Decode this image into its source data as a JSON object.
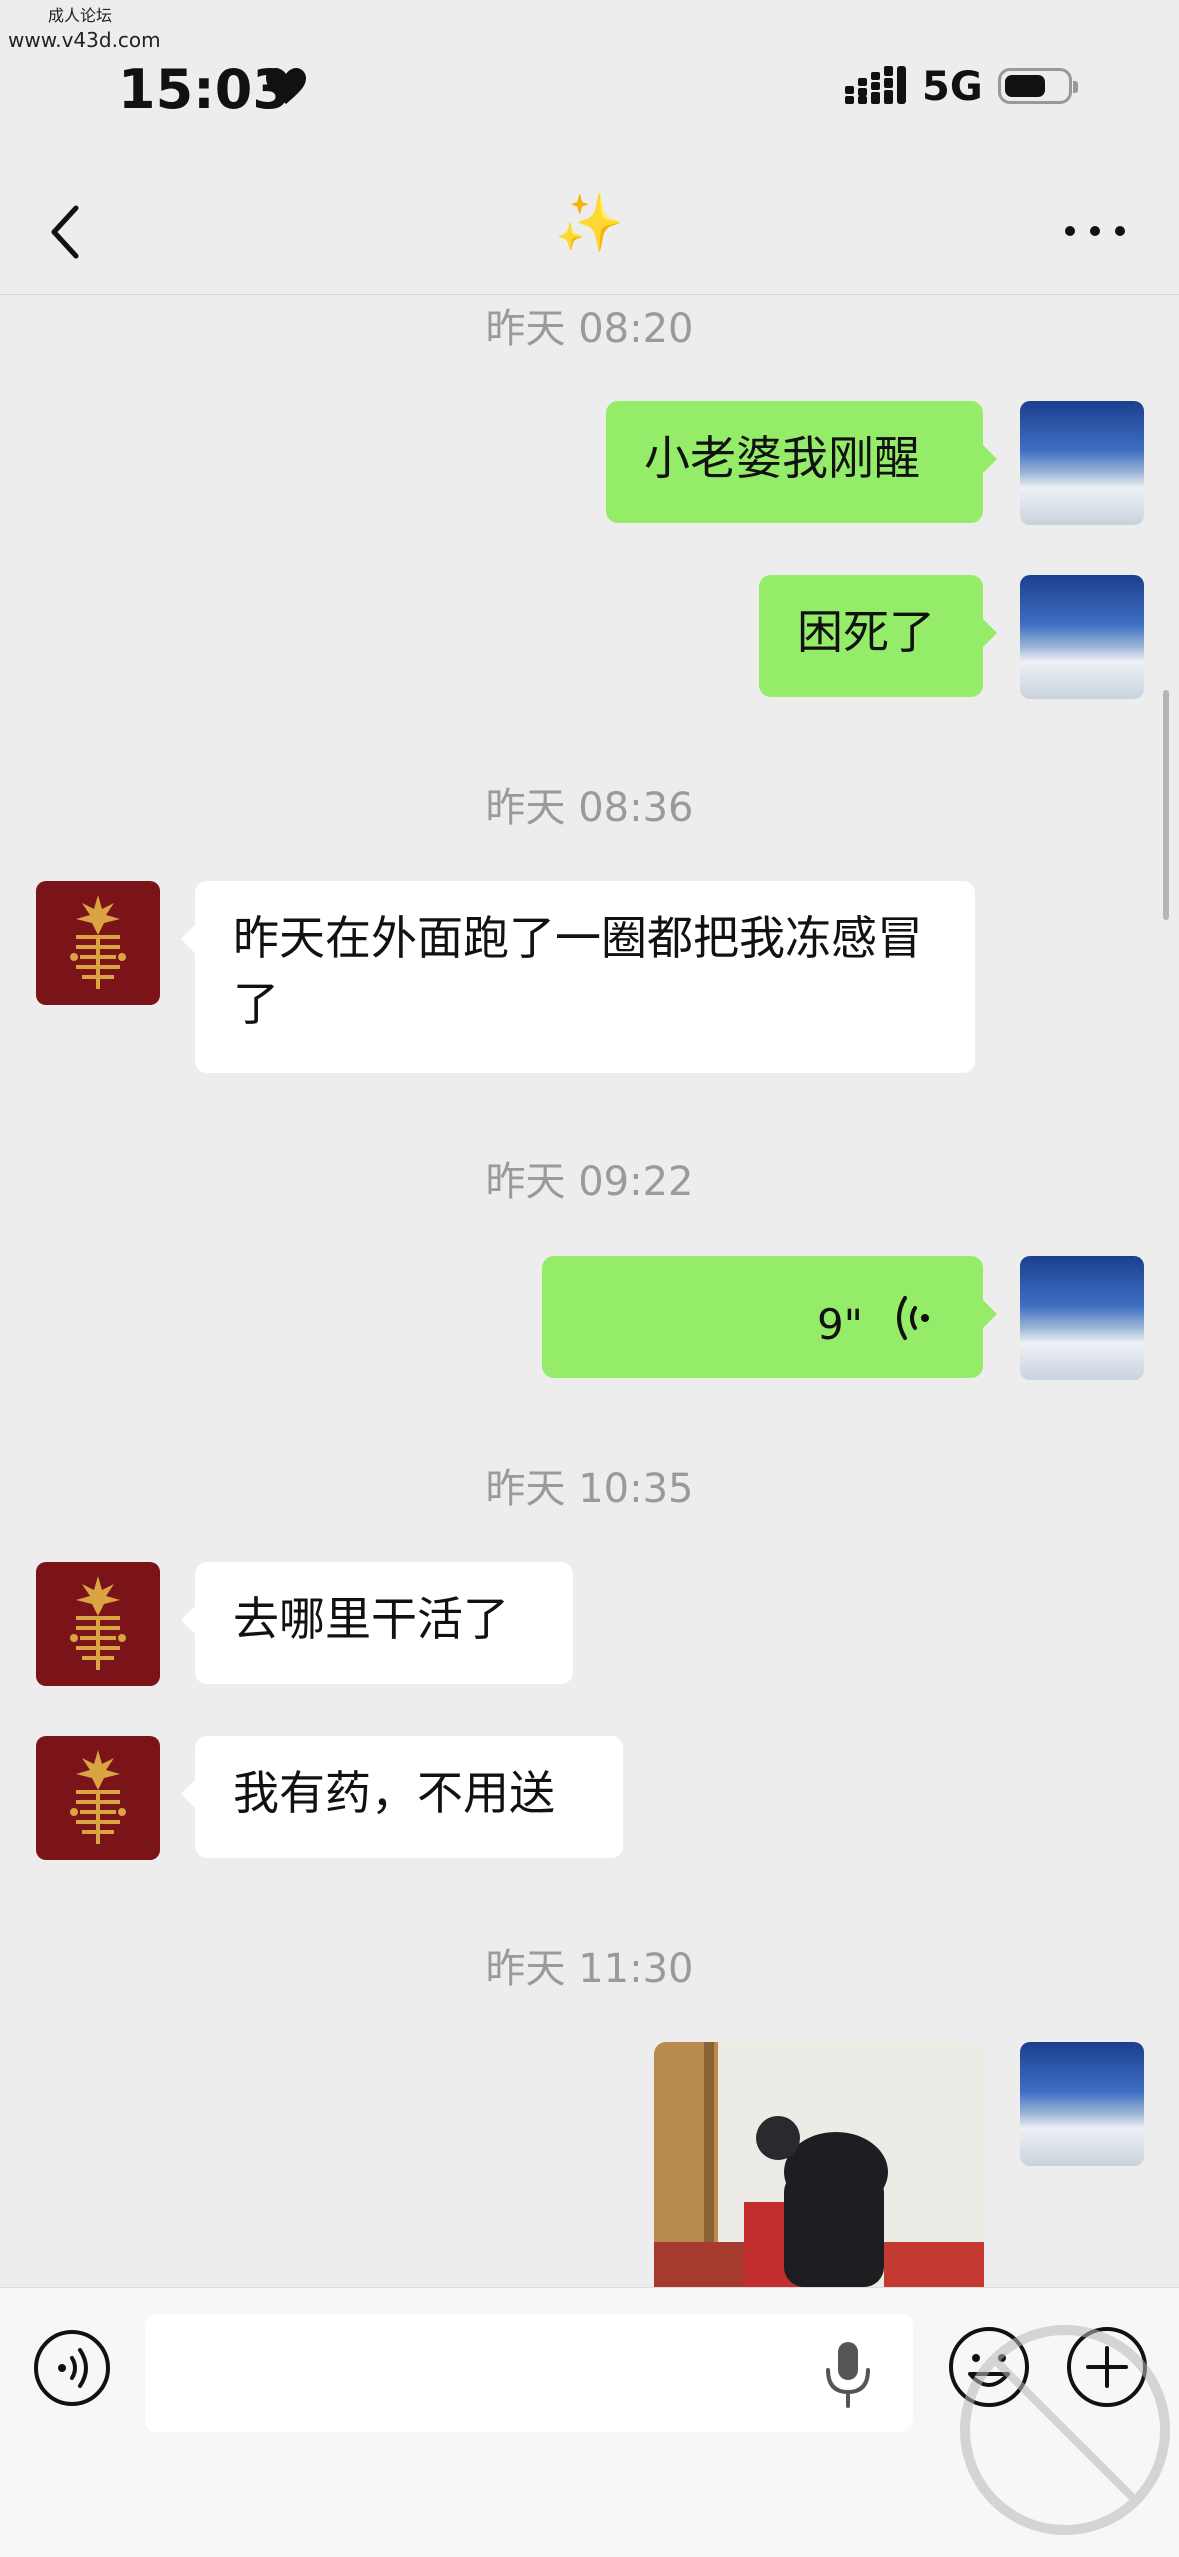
{
  "watermark": {
    "line1": "成人论坛",
    "line2": "www.v43d.com"
  },
  "status_bar": {
    "time": "15:03",
    "network": "5G"
  },
  "header": {
    "title": "✨"
  },
  "messages": [
    {
      "type": "time",
      "text": "昨天 08:20"
    },
    {
      "type": "text",
      "side": "out",
      "text": "小老婆我刚醒"
    },
    {
      "type": "text",
      "side": "out",
      "text": "困死了"
    },
    {
      "type": "time",
      "text": "昨天 08:36"
    },
    {
      "type": "text",
      "side": "in",
      "text": "昨天在外面跑了一圈都把我冻感冒了"
    },
    {
      "type": "time",
      "text": "昨天 09:22"
    },
    {
      "type": "voice",
      "side": "out",
      "duration": "9\""
    },
    {
      "type": "time",
      "text": "昨天 10:35"
    },
    {
      "type": "text",
      "side": "in",
      "text": "去哪里干活了"
    },
    {
      "type": "text",
      "side": "in",
      "text": "我有药，不用送"
    },
    {
      "type": "time",
      "text": "昨天 11:30"
    },
    {
      "type": "image",
      "side": "out"
    }
  ],
  "colors": {
    "out_bubble": "#95EC69",
    "in_bubble": "#FFFFFF",
    "background": "#EDEDED"
  },
  "icons": [
    "back-arrow-icon",
    "more-dots-icon",
    "voice-wave-icon",
    "voice-toggle-icon",
    "microphone-icon",
    "emoji-icon",
    "plus-icon"
  ]
}
